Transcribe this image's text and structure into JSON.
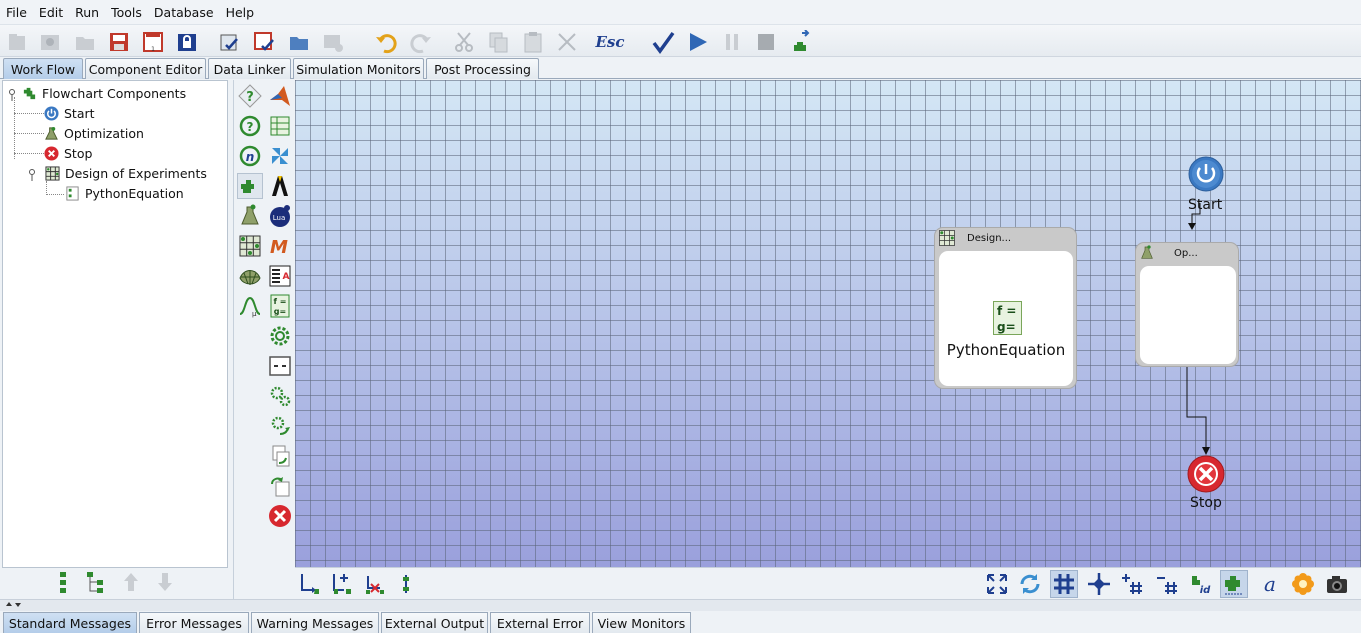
{
  "menubar": {
    "items": [
      "File",
      "Edit",
      "Run",
      "Tools",
      "Database",
      "Help"
    ]
  },
  "toolbar": {
    "esc_label": "Esc"
  },
  "tabs": [
    "Work Flow",
    "Component Editor",
    "Data Linker",
    "Simulation Monitors",
    "Post Processing"
  ],
  "active_tab": "Work Flow",
  "tree": {
    "root": "Flowchart Components",
    "items": [
      "Start",
      "Optimization",
      "Stop",
      "Design of Experiments"
    ],
    "child": "PythonEquation"
  },
  "canvas": {
    "start_label": "Start",
    "stop_label": "Stop",
    "doe_header": "Design...",
    "doe_content": "PythonEquation",
    "opt_header": "Op...",
    "equation_icon": "f =\ng="
  },
  "bottom_tabs": [
    "Standard Messages",
    "Error Messages",
    "Warning Messages",
    "External Output",
    "External Error",
    "View Monitors"
  ],
  "active_bottom_tab": "Standard Messages",
  "colors": {
    "accent": "#b4cde9",
    "start_icon": "#3a78c2",
    "stop_icon": "#d7282f",
    "puzzle": "#2f8a2f"
  }
}
